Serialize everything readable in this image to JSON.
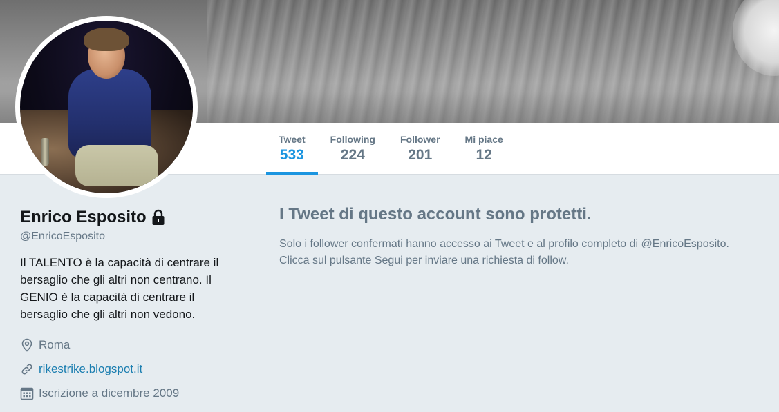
{
  "profile": {
    "name": "Enrico Esposito",
    "handle": "@EnricoEsposito",
    "bio": "Il TALENTO è la capacità di centrare il bersaglio che gli altri non centrano. Il GENIO è la capacità di centrare il bersaglio che gli altri non vedono.",
    "location": "Roma",
    "website": "rikestrike.blogspot.it",
    "joined": "Iscrizione a dicembre 2009"
  },
  "stats": [
    {
      "label": "Tweet",
      "value": "533",
      "active": true
    },
    {
      "label": "Following",
      "value": "224",
      "active": false
    },
    {
      "label": "Follower",
      "value": "201",
      "active": false
    },
    {
      "label": "Mi piace",
      "value": "12",
      "active": false
    }
  ],
  "protected": {
    "title": "I Tweet di questo account sono protetti.",
    "line1": "Solo i follower confermati hanno accesso ai Tweet e al profilo completo di @EnricoEsposito.",
    "line2": "Clicca sul pulsante Segui per inviare una richiesta di follow."
  },
  "colors": {
    "accent": "#1b95e0",
    "link": "#1b7eb0",
    "muted": "#657786",
    "background": "#e6ecf0"
  },
  "icons": {
    "lock": "lock-icon",
    "location": "location-pin-icon",
    "link": "link-icon",
    "calendar": "calendar-icon"
  }
}
